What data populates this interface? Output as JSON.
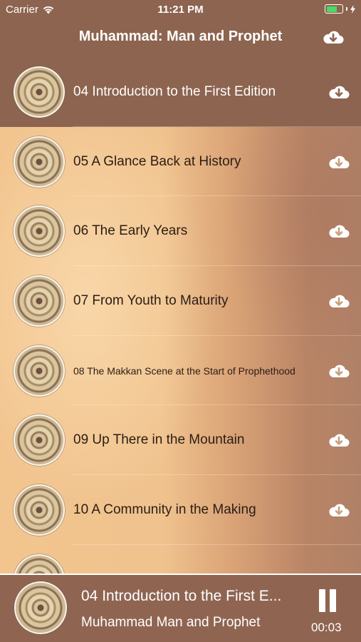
{
  "status_bar": {
    "carrier": "Carrier",
    "time": "11:21 PM"
  },
  "nav": {
    "title": "Muhammad: Man and Prophet",
    "download_icon": "cloud-download-icon"
  },
  "tracks": [
    {
      "title": "04 Introduction to the First Edition",
      "active": true
    },
    {
      "title": "05 A Glance Back at History",
      "active": false
    },
    {
      "title": "06 The Early Years",
      "active": false
    },
    {
      "title": "07 From Youth to Maturity",
      "active": false
    },
    {
      "title": "08 The Makkan Scene at the Start of Prophethood",
      "active": false
    },
    {
      "title": "09 Up There  in the Mountain",
      "active": false
    },
    {
      "title": "10 A Community in the Making",
      "active": false
    },
    {
      "title": "",
      "active": false
    }
  ],
  "player": {
    "title": "04 Introduction to the First E...",
    "subtitle": "Muhammad Man and Prophet",
    "time": "00:03",
    "pause_icon": "pause-icon"
  },
  "colors": {
    "bar": "#8d644f",
    "battery": "#4cd964",
    "text_dark": "#2b1d14"
  }
}
